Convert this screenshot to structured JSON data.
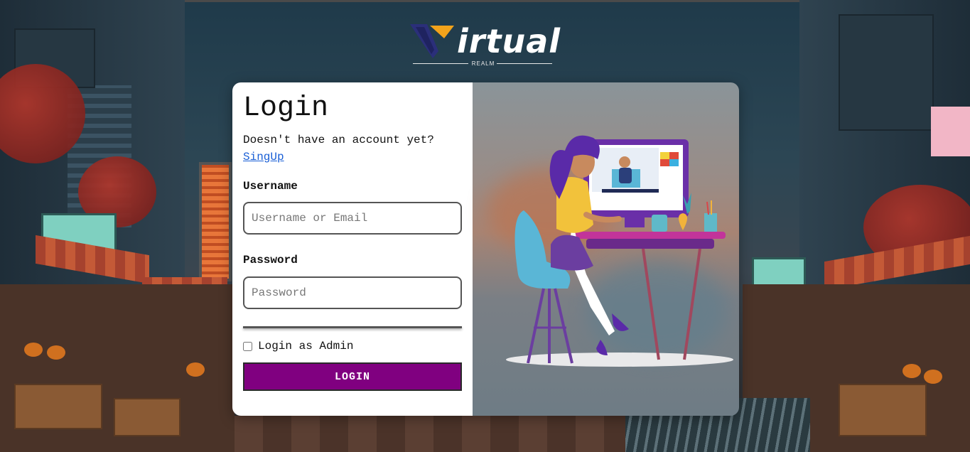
{
  "logo": {
    "text": "irtual",
    "subtitle": "REALM"
  },
  "login": {
    "title": "Login",
    "subtitle": "Doesn't have an account yet?",
    "signup_link": "SingUp",
    "username_label": "Username",
    "username_placeholder": "Username or Email",
    "username_value": "",
    "password_label": "Password",
    "password_placeholder": "Password",
    "password_value": "",
    "admin_checkbox_label": "Login as Admin",
    "admin_checked": false,
    "submit_label": "LOGIN"
  },
  "colors": {
    "accent": "#800080",
    "link": "#1a5fd6",
    "logo_navy": "#2b2f7a",
    "logo_gold": "#f2a31b"
  },
  "icons": {
    "logo_mark": "v-logo-icon",
    "illustration": "designer-at-desk-illustration"
  }
}
